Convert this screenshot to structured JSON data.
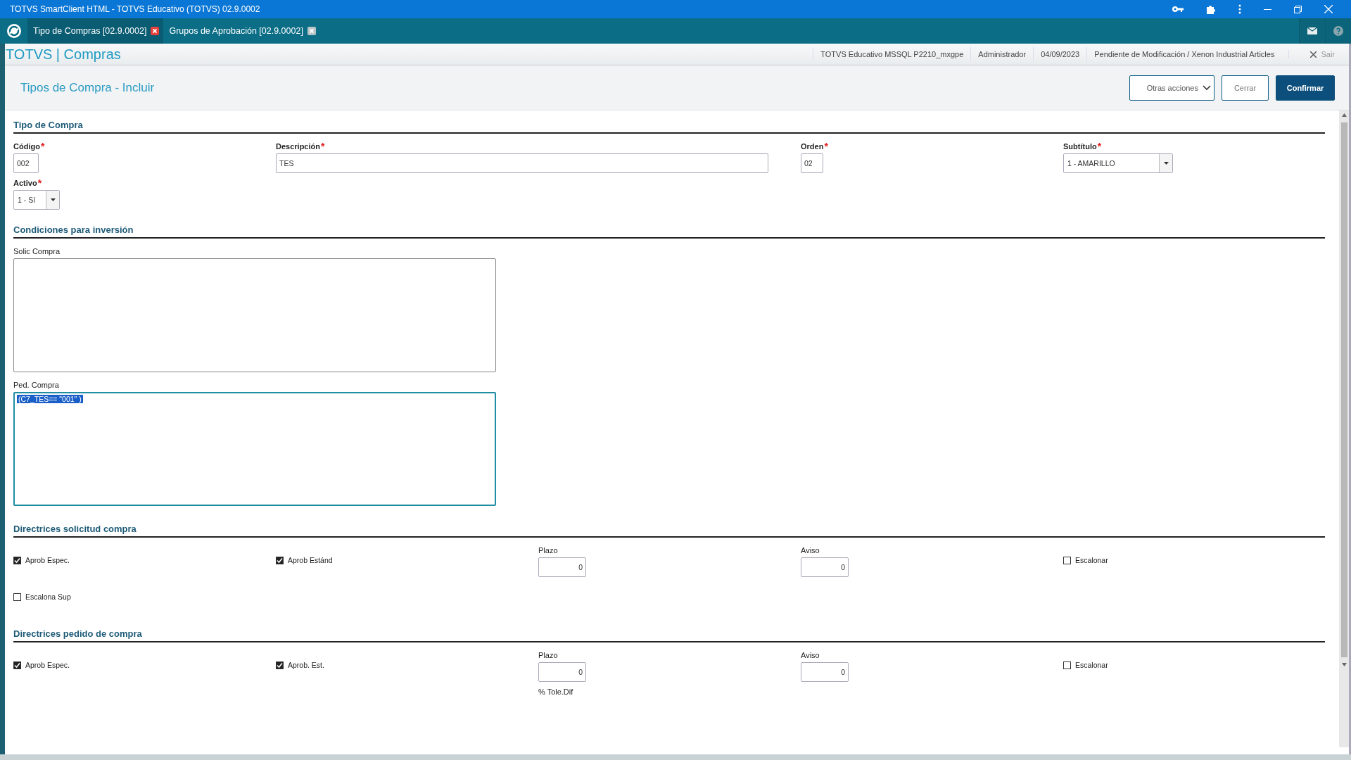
{
  "window": {
    "title": "TOTVS SmartClient HTML - TOTVS Educativo (TOTVS) 02.9.0002"
  },
  "tabs": [
    {
      "label": "Tipo de Compras [02.9.0002]",
      "selected": true
    },
    {
      "label": "Grupos de Aprobación [02.9.0002]",
      "selected": false
    }
  ],
  "app_header": {
    "title": "TOTVS | Compras",
    "info": [
      "TOTVS Educativo MSSQL P2210_mxgpe",
      "Administrador",
      "04/09/2023",
      "Pendiente de Modificación / Xenon Industrial Articles"
    ],
    "exit": "Sair"
  },
  "page": {
    "title": "Tipos de Compra - Incluir",
    "buttons": [
      {
        "label": "Otras acciones",
        "kind": "menu"
      },
      {
        "label": "Cerrar",
        "kind": "secondary"
      },
      {
        "label": "Confirmar",
        "kind": "primary"
      }
    ]
  },
  "sections": [
    {
      "title": "Tipo de Compra",
      "rows": [
        [
          {
            "kind": "short",
            "label": "Código",
            "required_mark": "*",
            "value": "002"
          },
          {
            "kind": "long",
            "label": "Descripción",
            "required_mark": "*",
            "value": "TES"
          },
          {
            "kind": "short",
            "label": "Orden",
            "required_mark": "*",
            "value": "02"
          },
          {
            "kind": "select",
            "label": "Subtítulo",
            "required_mark": "*",
            "value": "1 - AMARILLO"
          }
        ],
        [
          {
            "kind": "smallselect",
            "label": "Activo",
            "required_mark": "*",
            "value": "1 - Sí"
          }
        ]
      ]
    },
    {
      "title": "Condiciones para inversión",
      "rows": [
        [
          {
            "kind": "textarea",
            "label": "Solic Compra",
            "focused": false
          }
        ],
        [
          {
            "kind": "textarea",
            "label": "Ped. Compra",
            "value": "(C7_TES== \"001\" )",
            "focused": true
          }
        ]
      ]
    },
    {
      "title": "Directrices solicitud compra",
      "rows": [
        [
          {
            "kind": "checkbox",
            "label": "Aprob Espec.",
            "checked": true
          },
          {
            "kind": "checkbox",
            "label": "Aprob Estánd",
            "checked": true
          },
          {
            "kind": "number",
            "label": "Plazo",
            "value": "0"
          },
          {
            "kind": "number",
            "label": "Aviso",
            "value": "0"
          },
          {
            "kind": "checkbox",
            "label": "Escalonar",
            "checked": false
          }
        ],
        [
          {
            "kind": "checkbox",
            "label": "Escalona Sup",
            "checked": false
          }
        ]
      ]
    },
    {
      "title": "Directrices pedido de compra",
      "rows": [
        [
          {
            "kind": "checkbox",
            "label": "Aprob Espec.",
            "checked": true
          },
          {
            "kind": "checkbox",
            "label": "Aprob. Est.",
            "checked": true
          },
          {
            "kind": "number",
            "label": "Plazo",
            "value": "0"
          },
          {
            "kind": "number",
            "label": "Aviso",
            "value": "0"
          },
          {
            "kind": "checkbox",
            "label": "Escalonar",
            "checked": false
          }
        ],
        [
          "",
          "",
          {
            "kind": "caption",
            "label": "% Tole.Dif"
          }
        ]
      ]
    }
  ]
}
